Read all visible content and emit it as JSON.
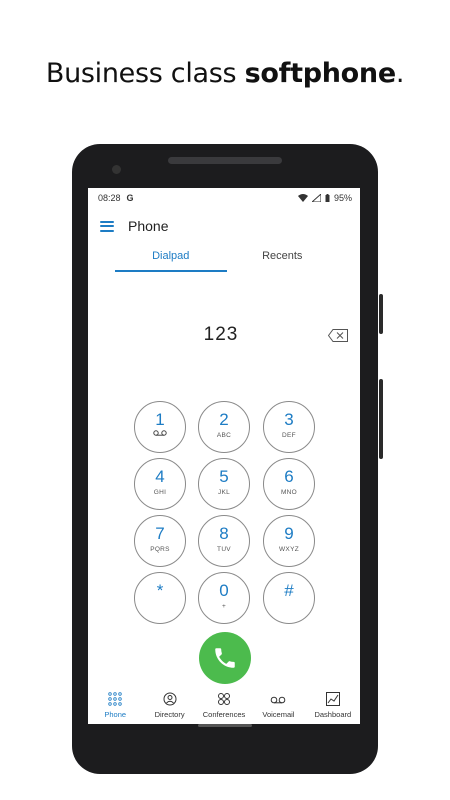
{
  "headline": {
    "normal": "Business class ",
    "bold": "softphone",
    "tail": "."
  },
  "status": {
    "time": "08:28",
    "g": "G",
    "battery": "95%"
  },
  "appbar": {
    "title": "Phone"
  },
  "tabs": [
    {
      "label": "Dialpad",
      "active": true
    },
    {
      "label": "Recents",
      "active": false
    }
  ],
  "dialed_number": "123",
  "keys": [
    {
      "digit": "1",
      "letters": ""
    },
    {
      "digit": "2",
      "letters": "ABC"
    },
    {
      "digit": "3",
      "letters": "DEF"
    },
    {
      "digit": "4",
      "letters": "GHI"
    },
    {
      "digit": "5",
      "letters": "JKL"
    },
    {
      "digit": "6",
      "letters": "MNO"
    },
    {
      "digit": "7",
      "letters": "PQRS"
    },
    {
      "digit": "8",
      "letters": "TUV"
    },
    {
      "digit": "9",
      "letters": "WXYZ"
    },
    {
      "digit": "*",
      "letters": ""
    },
    {
      "digit": "0",
      "letters": "+"
    },
    {
      "digit": "#",
      "letters": ""
    }
  ],
  "bottom_nav": [
    {
      "label": "Phone",
      "icon": "dialpad-grid-icon",
      "active": true
    },
    {
      "label": "Directory",
      "icon": "contact-icon",
      "active": false
    },
    {
      "label": "Conferences",
      "icon": "group-icon",
      "active": false
    },
    {
      "label": "Voicemail",
      "icon": "voicemail-icon",
      "active": false
    },
    {
      "label": "Dashboard",
      "icon": "chart-icon",
      "active": false
    }
  ],
  "colors": {
    "accent": "#1d7cc4",
    "call": "#4cbb4d",
    "frame": "#1c1c1e"
  }
}
